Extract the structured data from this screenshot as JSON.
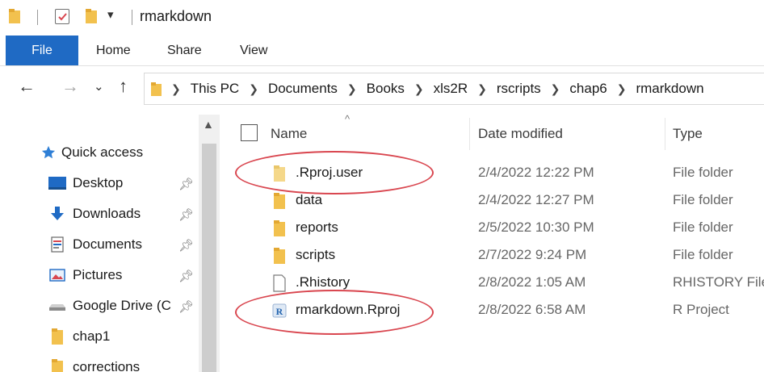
{
  "window": {
    "title": "rmarkdown"
  },
  "ribbon": {
    "tabs": [
      "File",
      "Home",
      "Share",
      "View"
    ]
  },
  "address": {
    "crumbs": [
      "This PC",
      "Documents",
      "Books",
      "xls2R",
      "rscripts",
      "chap6",
      "rmarkdown"
    ]
  },
  "nav": {
    "items": [
      {
        "label": "Quick access",
        "icon": "star-icon",
        "pinned": false
      },
      {
        "label": "Desktop",
        "icon": "desktop-icon",
        "pinned": true
      },
      {
        "label": "Downloads",
        "icon": "download-icon",
        "pinned": true
      },
      {
        "label": "Documents",
        "icon": "documents-icon",
        "pinned": true
      },
      {
        "label": "Pictures",
        "icon": "pictures-icon",
        "pinned": true
      },
      {
        "label": "Google Drive (C",
        "icon": "drive-icon",
        "pinned": true
      },
      {
        "label": "chap1",
        "icon": "folder-icon",
        "pinned": false
      },
      {
        "label": "corrections",
        "icon": "folder-icon",
        "pinned": false
      }
    ]
  },
  "list": {
    "columns": {
      "name": "Name",
      "date": "Date modified",
      "type": "Type"
    },
    "rows": [
      {
        "name": ".Rproj.user",
        "date": "2/4/2022 12:22 PM",
        "type": "File folder",
        "icon": "folder-icon"
      },
      {
        "name": "data",
        "date": "2/4/2022 12:27 PM",
        "type": "File folder",
        "icon": "folder-icon"
      },
      {
        "name": "reports",
        "date": "2/5/2022 10:30 PM",
        "type": "File folder",
        "icon": "folder-icon"
      },
      {
        "name": "scripts",
        "date": "2/7/2022 9:24 PM",
        "type": "File folder",
        "icon": "folder-icon"
      },
      {
        "name": ".Rhistory",
        "date": "2/8/2022 1:05 AM",
        "type": "RHISTORY File",
        "icon": "file-icon"
      },
      {
        "name": "rmarkdown.Rproj",
        "date": "2/8/2022 6:58 AM",
        "type": "R Project",
        "icon": "r-project-icon"
      }
    ]
  },
  "colors": {
    "accent": "#1f6ac4",
    "folder": "#f2c14e",
    "highlight": "#d9464f"
  }
}
